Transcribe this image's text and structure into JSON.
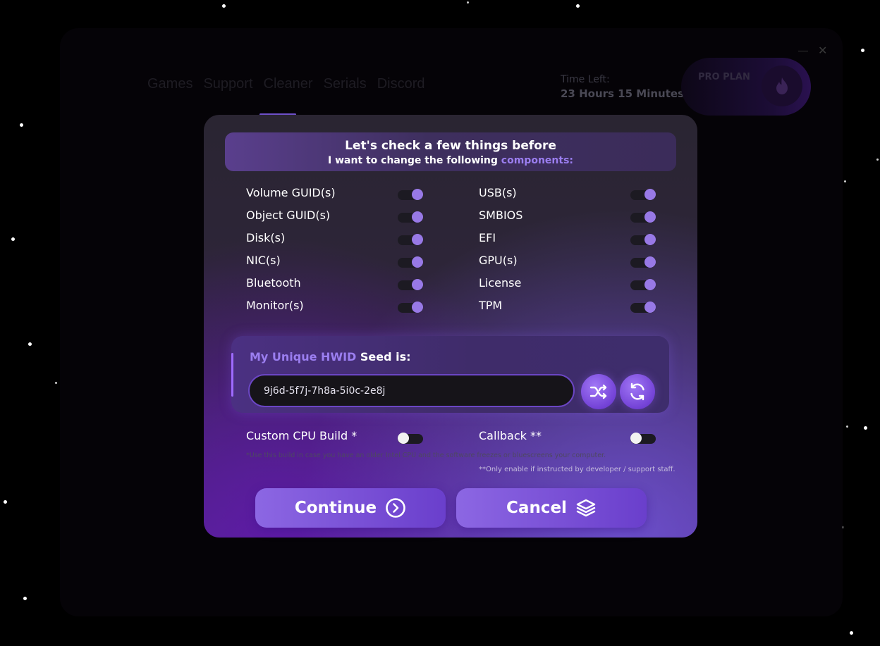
{
  "nav": {
    "items": [
      "Games",
      "Support",
      "Cleaner",
      "Serials",
      "Discord"
    ],
    "active_index": 2
  },
  "status": {
    "time_label": "Time Left:",
    "time_value": "23 Hours 15 Minutes",
    "plan": "PRO PLAN",
    "plan_icon": "flame-icon"
  },
  "dialog": {
    "title": "Let's check a few things before",
    "subtitle_prefix": "I want to change the following",
    "subtitle_accent": "components:",
    "components_left": [
      {
        "label": "Volume GUID(s)",
        "enabled": true
      },
      {
        "label": "Object GUID(s)",
        "enabled": true
      },
      {
        "label": "Disk(s)",
        "enabled": true
      },
      {
        "label": "NIC(s)",
        "enabled": true
      },
      {
        "label": "Bluetooth",
        "enabled": true
      },
      {
        "label": "Monitor(s)",
        "enabled": true
      }
    ],
    "components_right": [
      {
        "label": "USB(s)",
        "enabled": true
      },
      {
        "label": "SMBIOS",
        "enabled": true
      },
      {
        "label": "EFI",
        "enabled": true
      },
      {
        "label": "GPU(s)",
        "enabled": true
      },
      {
        "label": "License",
        "enabled": true
      },
      {
        "label": "TPM",
        "enabled": true
      }
    ],
    "seed": {
      "title_accent": "My Unique HWID",
      "title_rest": "Seed is:",
      "value": "9j6d-5f7j-7h8a-5i0c-2e8j",
      "shuffle_icon": "shuffle-icon",
      "refresh_icon": "refresh-icon"
    },
    "options": {
      "custom_cpu_label": "Custom CPU Build *",
      "custom_cpu_enabled": false,
      "callback_label": "Callback **",
      "callback_enabled": false
    },
    "notes": {
      "cpu_note": "*Use this build in case you have an older Intel CPU and the software freezes or bluescreens your computer.",
      "callback_note": "**Only enable if instructed by developer / support staff."
    },
    "buttons": {
      "continue": "Continue",
      "cancel": "Cancel"
    }
  },
  "colors": {
    "accent": "#9b7ef0",
    "toggle_on": "#9879e6",
    "button": "#7b52d7"
  }
}
